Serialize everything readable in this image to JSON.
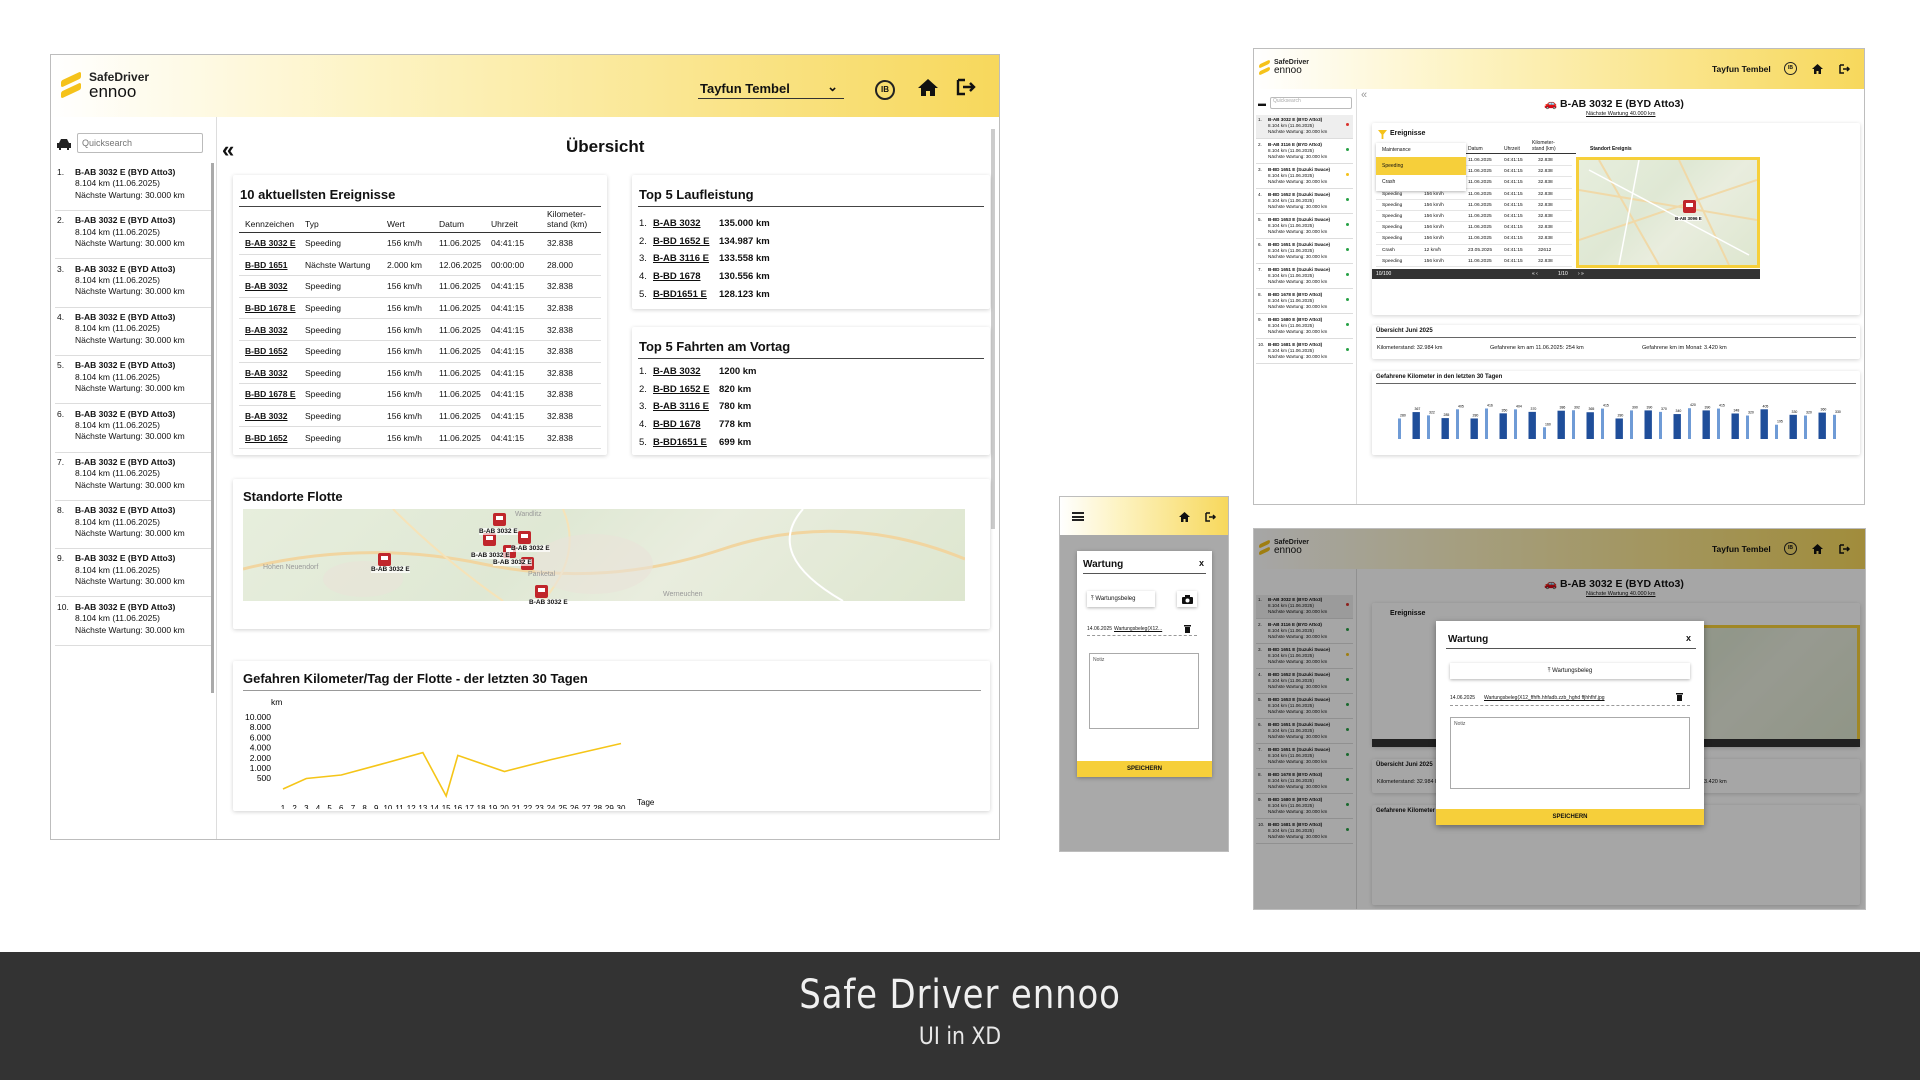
{
  "main": {
    "logo": {
      "line1": "SafeDriver",
      "line2": "ennoo"
    },
    "user": "Tayfun Tembel",
    "ib_label": "IB",
    "search_placeholder": "Quicksearch",
    "page_title": "Übersicht",
    "vehicles": [
      {
        "n": "1.",
        "name": "B-AB 3032 E (BYD Atto3)",
        "km": "8.104 km (11.06.2025)",
        "service": "Nächste Wartung: 30.000 km"
      },
      {
        "n": "2.",
        "name": "B-AB 3032 E (BYD Atto3)",
        "km": "8.104 km (11.06.2025)",
        "service": "Nächste Wartung: 30.000 km"
      },
      {
        "n": "3.",
        "name": "B-AB 3032 E (BYD Atto3)",
        "km": "8.104 km (11.06.2025)",
        "service": "Nächste Wartung: 30.000 km"
      },
      {
        "n": "4.",
        "name": "B-AB 3032 E (BYD Atto3)",
        "km": "8.104 km (11.06.2025)",
        "service": "Nächste Wartung: 30.000 km"
      },
      {
        "n": "5.",
        "name": "B-AB 3032 E (BYD Atto3)",
        "km": "8.104 km (11.06.2025)",
        "service": "Nächste Wartung: 30.000 km"
      },
      {
        "n": "6.",
        "name": "B-AB 3032 E (BYD Atto3)",
        "km": "8.104 km (11.06.2025)",
        "service": "Nächste Wartung: 30.000 km"
      },
      {
        "n": "7.",
        "name": "B-AB 3032 E (BYD Atto3)",
        "km": "8.104 km (11.06.2025)",
        "service": "Nächste Wartung: 30.000 km"
      },
      {
        "n": "8.",
        "name": "B-AB 3032 E (BYD Atto3)",
        "km": "8.104 km (11.06.2025)",
        "service": "Nächste Wartung: 30.000 km"
      },
      {
        "n": "9.",
        "name": "B-AB 3032 E (BYD Atto3)",
        "km": "8.104 km (11.06.2025)",
        "service": "Nächste Wartung: 30.000 km"
      },
      {
        "n": "10.",
        "name": "B-AB 3032 E (BYD Atto3)",
        "km": "8.104 km (11.06.2025)",
        "service": "Nächste Wartung: 30.000 km"
      }
    ],
    "events": {
      "title": "10 aktuellsten Ereignisse",
      "headers": [
        "Kennzeichen",
        "Typ",
        "Wert",
        "Datum",
        "Uhrzeit",
        "Kilometer-stand (km)"
      ],
      "rows": [
        [
          "B-AB 3032 E",
          "Speeding",
          "156 km/h",
          "11.06.2025",
          "04:41:15",
          "32.838"
        ],
        [
          "B-BD 1651",
          "Nächste Wartung",
          "2.000 km",
          "12.06.2025",
          "00:00:00",
          "28.000"
        ],
        [
          "B-AB 3032",
          "Speeding",
          "156 km/h",
          "11.06.2025",
          "04:41:15",
          "32.838"
        ],
        [
          "B-BD 1678 E",
          "Speeding",
          "156 km/h",
          "11.06.2025",
          "04:41:15",
          "32.838"
        ],
        [
          "B-AB 3032",
          "Speeding",
          "156 km/h",
          "11.06.2025",
          "04:41:15",
          "32.838"
        ],
        [
          "B-BD 1652",
          "Speeding",
          "156 km/h",
          "11.06.2025",
          "04:41:15",
          "32.838"
        ],
        [
          "B-AB 3032",
          "Speeding",
          "156 km/h",
          "11.06.2025",
          "04:41:15",
          "32.838"
        ],
        [
          "B-BD 1678 E",
          "Speeding",
          "156 km/h",
          "11.06.2025",
          "04:41:15",
          "32.838"
        ],
        [
          "B-AB 3032",
          "Speeding",
          "156 km/h",
          "11.06.2025",
          "04:41:15",
          "32.838"
        ],
        [
          "B-BD 1652",
          "Speeding",
          "156 km/h",
          "11.06.2025",
          "04:41:15",
          "32.838"
        ]
      ]
    },
    "top_mileage": {
      "title": "Top 5 Laufleistung",
      "rows": [
        {
          "n": "1.",
          "plate": "B-AB 3032",
          "val": "135.000 km"
        },
        {
          "n": "2.",
          "plate": "B-BD 1652 E",
          "val": "134.987 km"
        },
        {
          "n": "3.",
          "plate": "B-AB 3116 E",
          "val": "133.558 km"
        },
        {
          "n": "4.",
          "plate": "B-BD 1678",
          "val": "130.556 km"
        },
        {
          "n": "5.",
          "plate": "B-BD1651 E",
          "val": "128.123 km"
        }
      ]
    },
    "top_trips": {
      "title": "Top 5 Fahrten am Vortag",
      "rows": [
        {
          "n": "1.",
          "plate": "B-AB 3032",
          "val": "1200 km"
        },
        {
          "n": "2.",
          "plate": "B-BD 1652 E",
          "val": "820 km"
        },
        {
          "n": "3.",
          "plate": "B-AB 3116 E",
          "val": "780 km"
        },
        {
          "n": "4.",
          "plate": "B-BD 1678",
          "val": "778 km"
        },
        {
          "n": "5.",
          "plate": "B-BD1651 E",
          "val": "699 km"
        }
      ]
    },
    "fleet_map": {
      "title": "Standorte Flotte",
      "places": [
        "Hohen Neuendorf",
        "Panketal",
        "Werneuchen",
        "Wandlitz"
      ],
      "markers": [
        "B-AB 3032 E",
        "B-AB 3032 E",
        "B-AB 3032 E",
        "B-AB 3032 E",
        "B-AB 3032 E",
        "B-AB 3032 E"
      ]
    },
    "km_chart_title": "Gefahren Kilometer/Tag der Flotte - der letzten 30 Tagen"
  },
  "chart_data": {
    "type": "line",
    "title": "",
    "xlabel": "Tage",
    "ylabel": "km",
    "x": [
      1,
      2,
      3,
      4,
      5,
      6,
      7,
      8,
      9,
      10,
      11,
      12,
      13,
      14,
      15,
      16,
      17,
      18,
      19,
      20,
      21,
      22,
      23,
      24,
      25,
      26,
      27,
      28,
      29,
      30
    ],
    "y_ticks": [
      "10.000",
      "8.000",
      "6.000",
      "4.000",
      "2.000",
      "1.000",
      "500"
    ],
    "series": [
      {
        "color": "#f5c518",
        "points": [
          [
            1,
            1000
          ],
          [
            3,
            2500
          ],
          [
            6,
            3000
          ],
          [
            10,
            4800
          ],
          [
            13,
            6200
          ],
          [
            15,
            0
          ],
          [
            16,
            5800
          ],
          [
            20,
            3500
          ],
          [
            24,
            5200
          ],
          [
            30,
            7500
          ]
        ]
      }
    ],
    "ylim": [
      0,
      10000
    ],
    "grid": false
  },
  "detail": {
    "user": "Tayfun Tembel",
    "title": "B-AB 3032 E (BYD Atto3)",
    "subtitle": "Nächste Wartung 40.000 km",
    "filter_label": "Ereignisse",
    "filter_options": [
      "Maintenance",
      "Speeding",
      "Crash"
    ],
    "col_headers": [
      "Datum",
      "Uhrzeit",
      "Kilometer-stand (km)",
      "Standort Ereignis"
    ],
    "pager": "1/10",
    "count": "10/100",
    "overview_title": "Übersicht Juni 2025",
    "overview": {
      "odo": "Kilometerstand: 32.984 km",
      "day": "Gefahrene km am 11.06.2025: 254 km",
      "month": "Gefahrene km im Monat: 3.420 km"
    },
    "bars_title": "Gefahrene Kilometer in den letzten 30 Tagen",
    "side": [
      {
        "n": "1.",
        "name": "B-AB 3032 E (BYD Atto3)"
      },
      {
        "n": "2.",
        "name": "B-AB 3116 E (BYD Atto3)"
      },
      {
        "n": "3.",
        "name": "B-BD 1651 E (Suzuki Swace)"
      },
      {
        "n": "4.",
        "name": "B-BD 1652 E (Suzuki Swace)"
      },
      {
        "n": "5.",
        "name": "B-BD 1653 E (Suzuki Swace)"
      },
      {
        "n": "6.",
        "name": "B-BD 1651 E (Suzuki Swace)"
      },
      {
        "n": "7.",
        "name": "B-BD 1651 E (Suzuki Swace)"
      },
      {
        "n": "8.",
        "name": "B-BD 1678 E (BYD Atto3)"
      },
      {
        "n": "9.",
        "name": "B-BD 1680 E (BYD Atto3)"
      },
      {
        "n": "10.",
        "name": "B-BD 1681 E (BYD Atto3)"
      }
    ],
    "map_marker": "B-AB 3096 E"
  },
  "mobile": {
    "dialog_title": "Wartung",
    "close": "x",
    "upload": "Wartungsbeleg",
    "file_date": "14.06.2025",
    "file_name": "Wartungsbeleg(X12...",
    "note_placeholder": "Notiz",
    "save": "SPEICHERN"
  },
  "modal": {
    "title": "Wartung",
    "close": "x",
    "upload": "Wartungsbeleg",
    "file_date": "14.06.2025",
    "file_name": "Wartungsbeleg(X12_ffhfh.hhfadb.zzb_hghd ffjhhfhf.jpg",
    "note_placeholder": "Notiz",
    "save": "SPEICHERN"
  },
  "footer": {
    "title": "Safe Driver ennoo",
    "subtitle": "UI in XD"
  }
}
